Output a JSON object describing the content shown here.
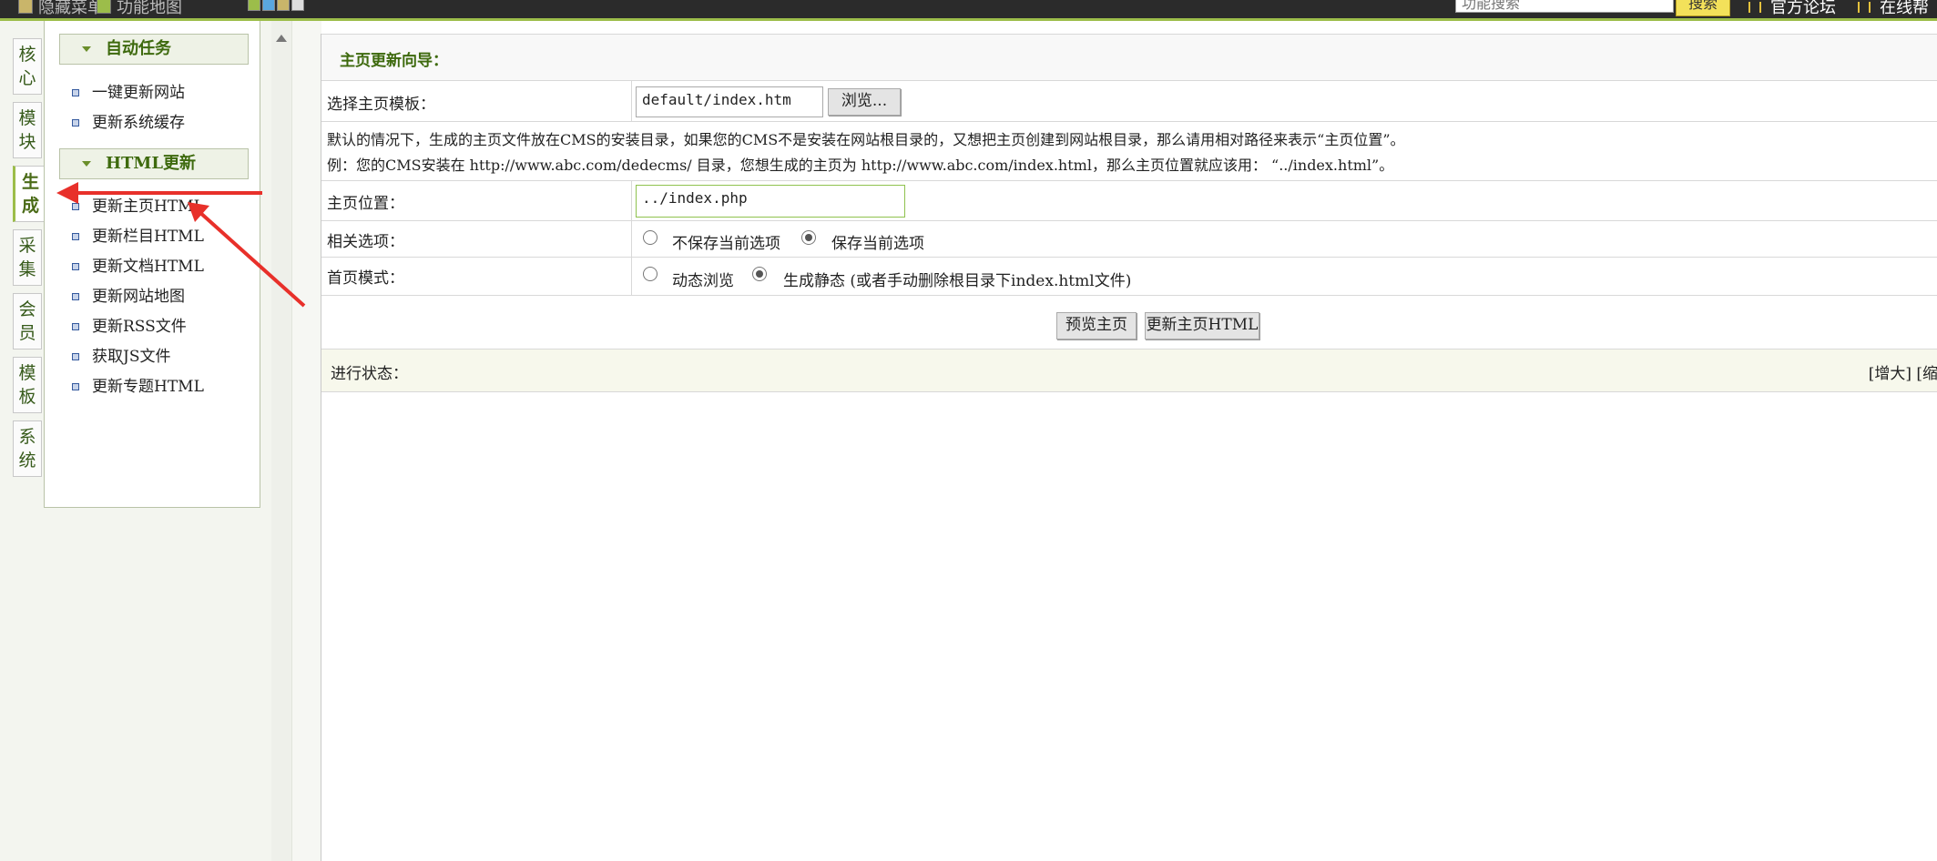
{
  "topbar": {
    "hide_menu": "隐藏菜单",
    "func_map": "功能地图",
    "search_placeholder": "功能搜索",
    "search_button": "搜索",
    "forum": "官方论坛",
    "online_help": "在线帮"
  },
  "sidebar": {
    "tabs": [
      {
        "label": "核心"
      },
      {
        "label": "模块"
      },
      {
        "label": "生成"
      },
      {
        "label": "采集"
      },
      {
        "label": "会员"
      },
      {
        "label": "模板"
      },
      {
        "label": "系统"
      }
    ],
    "sections": [
      {
        "title": "自动任务",
        "items": [
          "一键更新网站",
          "更新系统缓存"
        ]
      },
      {
        "title": "HTML更新",
        "items": [
          "更新主页HTML",
          "更新栏目HTML",
          "更新文档HTML",
          "更新网站地图",
          "更新RSS文件",
          "获取JS文件",
          "更新专题HTML"
        ]
      }
    ]
  },
  "main": {
    "title": "主页更新向导：",
    "template_label": "选择主页模板：",
    "template_value": "default/index.htm",
    "browse_button": "浏览...",
    "note_line1": "默认的情况下，生成的主页文件放在CMS的安装目录，如果您的CMS不是安装在网站根目录的，又想把主页创建到网站根目录，那么请用相对路径来表示“主页位置”。",
    "note_line2": "例：您的CMS安装在 http://www.abc.com/dedecms/ 目录，您想生成的主页为 http://www.abc.com/index.html，那么主页位置就应该用： “../index.html”。",
    "location_label": "主页位置：",
    "location_value": "../index.php",
    "options_label": "相关选项：",
    "option_no_save": "不保存当前选项",
    "option_save": "保存当前选项",
    "mode_label": "首页模式：",
    "mode_dynamic": "动态浏览",
    "mode_static": "生成静态 (或者手动删除根目录下index.html文件)",
    "preview_button": "预览主页",
    "update_button": "更新主页HTML",
    "status_label": "进行状态：",
    "status_enlarge": "[增大]",
    "status_shrink": "[缩"
  },
  "colors": {
    "accent_green": "#9cbd4a",
    "heading_green": "#3e6a0e",
    "annotation_arrow": "#e8302a"
  }
}
